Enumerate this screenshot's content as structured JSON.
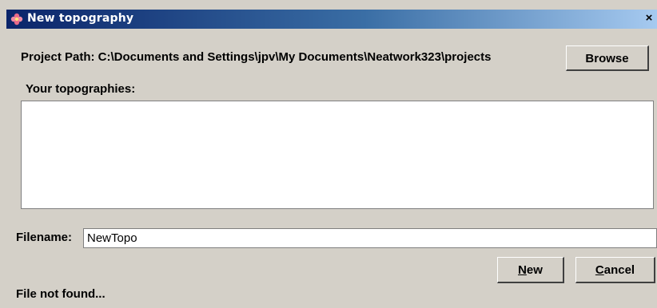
{
  "window": {
    "title": "New topography",
    "close_glyph": "×",
    "icon": "app-flower-icon"
  },
  "project": {
    "path_label": "Project Path: C:\\Documents and Settings\\jpv\\My Documents\\Neatwork323\\projects",
    "browse_label": "Browse"
  },
  "topographies": {
    "label": "Your topographies:",
    "items": []
  },
  "filename": {
    "label": "Filename:",
    "value": "NewTopo"
  },
  "buttons": {
    "new_mnemonic": "N",
    "new_rest": "ew",
    "cancel_mnemonic": "C",
    "cancel_rest": "ancel"
  },
  "status": {
    "text": "File not found..."
  },
  "colors": {
    "titlebar_start": "#0a246a",
    "titlebar_end": "#a6caf0",
    "dialog_background": "#d4d0c8"
  }
}
